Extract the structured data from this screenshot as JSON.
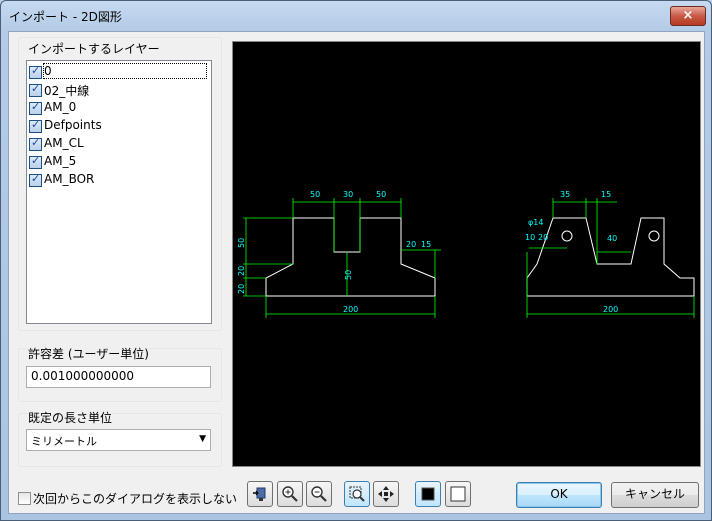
{
  "window": {
    "title": "インポート - 2D図形",
    "close_label": "×"
  },
  "layers": {
    "label": "インポートするレイヤー",
    "items": [
      {
        "name": "0",
        "checked": true
      },
      {
        "name": "02_中線",
        "checked": true
      },
      {
        "name": "AM_0",
        "checked": true
      },
      {
        "name": "Defpoints",
        "checked": true
      },
      {
        "name": "AM_CL",
        "checked": true
      },
      {
        "name": "AM_5",
        "checked": true
      },
      {
        "name": "AM_BOR",
        "checked": true
      }
    ],
    "check_mark": "✓"
  },
  "tolerance": {
    "label": "許容差 (ユーザー単位)",
    "value": "0.001000000000"
  },
  "length_unit": {
    "label": "既定の長さ単位",
    "selected": "ミリメートル",
    "arrow": "▼"
  },
  "dont_show": {
    "label": "次回からこのダイアログを表示しない",
    "checked": false
  },
  "buttons": {
    "ok": "OK",
    "cancel": "キャンセル"
  },
  "toolbar": [
    "layer-import-icon",
    "zoom-in-icon",
    "zoom-out-icon",
    "zoom-window-icon",
    "pan-icon",
    "black-background-icon",
    "white-background-icon"
  ],
  "colors": {
    "shape": "#ffffff",
    "dimension": "#00ff00",
    "dim_text": "#00ffff",
    "background": "#000000"
  },
  "drawing": {
    "left_part": {
      "dims": [
        "50",
        "30",
        "50",
        "50",
        "20",
        "20",
        "20",
        "15",
        "50",
        "200"
      ]
    },
    "right_part": {
      "dims": [
        "35",
        "15",
        "φ14",
        "10",
        "20",
        "40",
        "200"
      ]
    }
  }
}
